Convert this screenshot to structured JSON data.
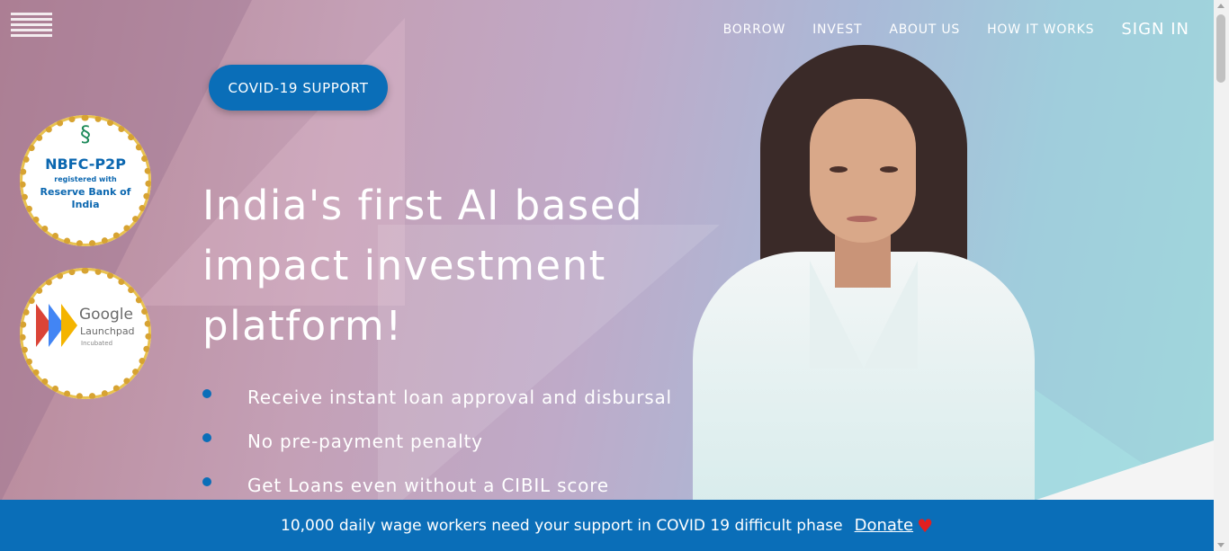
{
  "nav": {
    "items": [
      "BORROW",
      "INVEST",
      "ABOUT US",
      "HOW IT WORKS"
    ],
    "signin": "SIGN IN"
  },
  "covid_button": "COVID-19 SUPPORT",
  "badges": {
    "nbfc": {
      "title": "NBFC-P2P",
      "sub": "registered with",
      "rbi": "Reserve Bank of India"
    },
    "google": {
      "title": "Google",
      "sub": "Launchpad",
      "tag": "Incubated"
    }
  },
  "hero": {
    "headline": "India's first AI based impact investment platform!",
    "bullets": [
      "Receive instant loan approval and disbursal",
      "No pre-payment penalty",
      "Get Loans even without a CIBIL score"
    ]
  },
  "banner": {
    "text": "10,000 daily wage workers need your support in COVID 19 difficult phase",
    "donate": "Donate"
  },
  "colors": {
    "primary": "#0a6eb8",
    "heart": "#e41f1f"
  },
  "icons": [
    "logo",
    "rbi-emblem-icon",
    "google-launchpad-icon",
    "heart-icon"
  ]
}
